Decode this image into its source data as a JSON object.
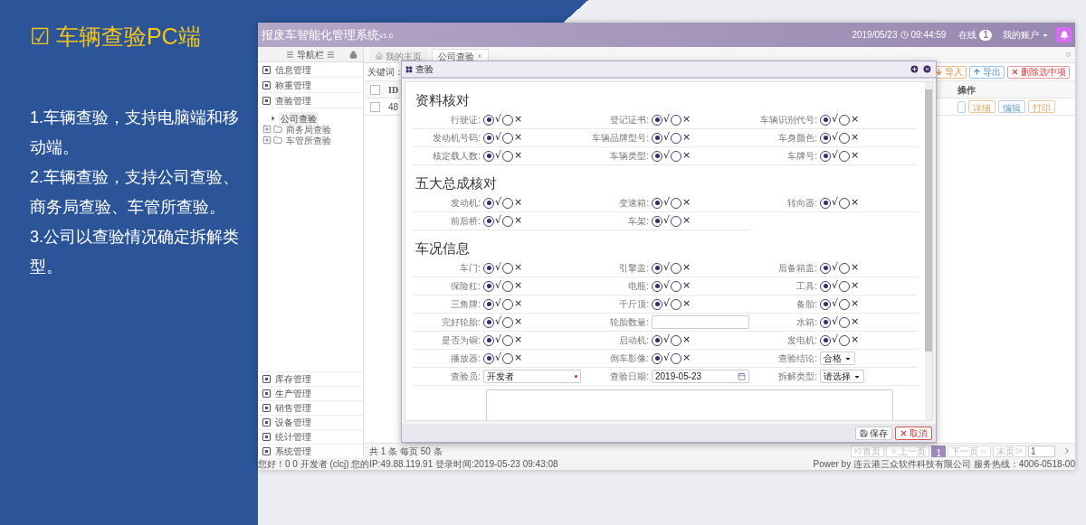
{
  "slide": {
    "title": "☑ 车辆查验PC端",
    "points": [
      "1.车辆查验，支持电脑端和移动端。",
      "2.车辆查验，支持公司查验、商务局查验、车管所查验。",
      "3.公司以查验情况确定拆解类型。"
    ]
  },
  "app": {
    "title": "报废车智能化管理系统",
    "version": "v1.0",
    "date": "2019/05/23",
    "time": "09:44:59",
    "online_label": "在线",
    "online_count": "1",
    "account": "我的账户"
  },
  "sidebar": {
    "title": "导航栏",
    "items": [
      {
        "label": "信息管理"
      },
      {
        "label": "称重管理"
      },
      {
        "label": "查验管理",
        "children": [
          {
            "kind": "leaf",
            "label": "公司查验",
            "selected": true
          },
          {
            "kind": "folder",
            "label": "商务局查验",
            "selected": false
          },
          {
            "kind": "folder",
            "label": "车管所查验",
            "selected": false
          }
        ]
      }
    ],
    "bottom_items": [
      "库存管理",
      "生产管理",
      "销售管理",
      "设备管理",
      "统计管理",
      "系统管理"
    ]
  },
  "tabs": [
    {
      "kind": "home",
      "label": "我的主页",
      "selected": false,
      "closable": false
    },
    {
      "kind": "page",
      "label": "公司查验",
      "selected": true,
      "closable": true
    }
  ],
  "toolbar": {
    "keyword_label": "关键词：",
    "buttons": [
      {
        "kind": "import",
        "label": "导入"
      },
      {
        "kind": "export",
        "label": "导出"
      },
      {
        "kind": "delete",
        "label": "删除选中项"
      }
    ]
  },
  "table": {
    "id_column": "ID",
    "action_column": "操作",
    "header_checked": false,
    "rows": [
      {
        "id": "48",
        "checked": false,
        "actions": [
          {
            "kind": "detail",
            "label": "详细"
          },
          {
            "kind": "edit",
            "label": "编辑"
          },
          {
            "kind": "print",
            "label": "打印"
          }
        ]
      }
    ]
  },
  "pagination": {
    "summary": "共 1 条 每页 50 条",
    "before": [
      {
        "kind": "first",
        "label": "首页",
        "disabled": true
      },
      {
        "kind": "prev",
        "label": "上一页",
        "disabled": true
      }
    ],
    "pages": [
      {
        "label": "1",
        "selected": true
      }
    ],
    "after": [
      {
        "kind": "next",
        "label": "下一页",
        "disabled": true
      },
      {
        "kind": "last",
        "label": "末页",
        "disabled": true
      }
    ],
    "page_input": "1"
  },
  "status_bar": {
    "left": "您好！0 0 开发者 (clcj) 您的IP:49.88.119.91 登录时间:2019-05-23 09:43:08",
    "right": "Power by 连云港三众软件科技有限公司 服务热线：4006-0518-00"
  },
  "modal": {
    "title": "查验",
    "sections": [
      {
        "title": "资料核对",
        "fields": [
          {
            "kind": "radio",
            "label": "行驶证:",
            "options": [
              {
                "label": "√",
                "selected": true
              },
              {
                "label": "×",
                "selected": false
              }
            ]
          },
          {
            "kind": "radio",
            "label": "登记证书:",
            "options": [
              {
                "label": "√",
                "selected": true
              },
              {
                "label": "×",
                "selected": false
              }
            ]
          },
          {
            "kind": "radio",
            "label": "车辆识别代号:",
            "options": [
              {
                "label": "√",
                "selected": true
              },
              {
                "label": "×",
                "selected": false
              }
            ]
          },
          {
            "kind": "radio",
            "label": "发动机号码:",
            "options": [
              {
                "label": "√",
                "selected": true
              },
              {
                "label": "×",
                "selected": false
              }
            ]
          },
          {
            "kind": "radio",
            "label": "车辆品牌型号:",
            "options": [
              {
                "label": "√",
                "selected": true
              },
              {
                "label": "×",
                "selected": false
              }
            ]
          },
          {
            "kind": "radio",
            "label": "车身颜色:",
            "options": [
              {
                "label": "√",
                "selected": true
              },
              {
                "label": "×",
                "selected": false
              }
            ]
          },
          {
            "kind": "radio",
            "label": "核定载人数:",
            "options": [
              {
                "label": "√",
                "selected": true
              },
              {
                "label": "×",
                "selected": false
              }
            ]
          },
          {
            "kind": "radio",
            "label": "车辆类型:",
            "options": [
              {
                "label": "√",
                "selected": true
              },
              {
                "label": "×",
                "selected": false
              }
            ]
          },
          {
            "kind": "radio",
            "label": "车牌号:",
            "options": [
              {
                "label": "√",
                "selected": true
              },
              {
                "label": "×",
                "selected": false
              }
            ]
          }
        ]
      },
      {
        "title": "五大总成核对",
        "fields": [
          {
            "kind": "radio",
            "label": "发动机:",
            "options": [
              {
                "label": "√",
                "selected": true
              },
              {
                "label": "×",
                "selected": false
              }
            ]
          },
          {
            "kind": "radio",
            "label": "变速箱:",
            "options": [
              {
                "label": "√",
                "selected": true
              },
              {
                "label": "×",
                "selected": false
              }
            ]
          },
          {
            "kind": "radio",
            "label": "转向器:",
            "options": [
              {
                "label": "√",
                "selected": true
              },
              {
                "label": "×",
                "selected": false
              }
            ]
          },
          {
            "kind": "radio",
            "label": "前后桥:",
            "options": [
              {
                "label": "√",
                "selected": true
              },
              {
                "label": "×",
                "selected": false
              }
            ]
          },
          {
            "kind": "radio",
            "label": "车架:",
            "options": [
              {
                "label": "√",
                "selected": true
              },
              {
                "label": "×",
                "selected": false
              }
            ]
          }
        ]
      },
      {
        "title": "车况信息",
        "fields": [
          {
            "kind": "radio",
            "label": "车门:",
            "options": [
              {
                "label": "√",
                "selected": true
              },
              {
                "label": "×",
                "selected": false
              }
            ]
          },
          {
            "kind": "radio",
            "label": "引擎盖:",
            "options": [
              {
                "label": "√",
                "selected": true
              },
              {
                "label": "×",
                "selected": false
              }
            ]
          },
          {
            "kind": "radio",
            "label": "后备箱盖:",
            "options": [
              {
                "label": "√",
                "selected": true
              },
              {
                "label": "×",
                "selected": false
              }
            ]
          },
          {
            "kind": "radio",
            "label": "保险杠:",
            "options": [
              {
                "label": "√",
                "selected": true
              },
              {
                "label": "×",
                "selected": false
              }
            ]
          },
          {
            "kind": "radio",
            "label": "电瓶:",
            "options": [
              {
                "label": "√",
                "selected": true
              },
              {
                "label": "×",
                "selected": false
              }
            ]
          },
          {
            "kind": "radio",
            "label": "工具:",
            "options": [
              {
                "label": "√",
                "selected": true
              },
              {
                "label": "×",
                "selected": false
              }
            ]
          },
          {
            "kind": "radio",
            "label": "三角牌:",
            "options": [
              {
                "label": "√",
                "selected": true
              },
              {
                "label": "×",
                "selected": false
              }
            ]
          },
          {
            "kind": "radio",
            "label": "千斤顶:",
            "options": [
              {
                "label": "√",
                "selected": true
              },
              {
                "label": "×",
                "selected": false
              }
            ]
          },
          {
            "kind": "radio",
            "label": "备胎:",
            "options": [
              {
                "label": "√",
                "selected": true
              },
              {
                "label": "×",
                "selected": false
              }
            ]
          },
          {
            "kind": "radio",
            "label": "完好轮胎:",
            "options": [
              {
                "label": "√",
                "selected": true
              },
              {
                "label": "×",
                "selected": false
              }
            ]
          },
          {
            "kind": "text",
            "label": "轮胎数量:",
            "required": false
          },
          {
            "kind": "radio",
            "label": "水箱:",
            "options": [
              {
                "label": "√",
                "selected": true
              },
              {
                "label": "×",
                "selected": false
              }
            ]
          },
          {
            "kind": "radio",
            "label": "是否为铜:",
            "options": [
              {
                "label": "√",
                "selected": true
              },
              {
                "label": "×",
                "selected": false
              }
            ]
          },
          {
            "kind": "radio",
            "label": "启动机:",
            "options": [
              {
                "label": "√",
                "selected": true
              },
              {
                "label": "×",
                "selected": false
              }
            ]
          },
          {
            "kind": "radio",
            "label": "发电机:",
            "options": [
              {
                "label": "√",
                "selected": true
              },
              {
                "label": "×",
                "selected": false
              }
            ]
          },
          {
            "kind": "radio",
            "label": "播放器:",
            "options": [
              {
                "label": "√",
                "selected": true
              },
              {
                "label": "×",
                "selected": false
              }
            ]
          },
          {
            "kind": "radio",
            "label": "倒车影像:",
            "options": [
              {
                "label": "√",
                "selected": true
              },
              {
                "label": "×",
                "selected": false
              }
            ]
          },
          {
            "kind": "select",
            "label": "查验结论:",
            "value": "合格"
          },
          {
            "kind": "text",
            "label": "查验员:",
            "value": "开发者",
            "required": true
          },
          {
            "kind": "date",
            "label": "查验日期:",
            "value": "2019-05-23"
          },
          {
            "kind": "select",
            "label": "拆解类型:",
            "value": "请选择"
          },
          {
            "kind": "textarea"
          }
        ]
      }
    ],
    "buttons": [
      {
        "kind": "save",
        "label": "保存"
      },
      {
        "kind": "cancel",
        "label": "取消"
      }
    ]
  }
}
